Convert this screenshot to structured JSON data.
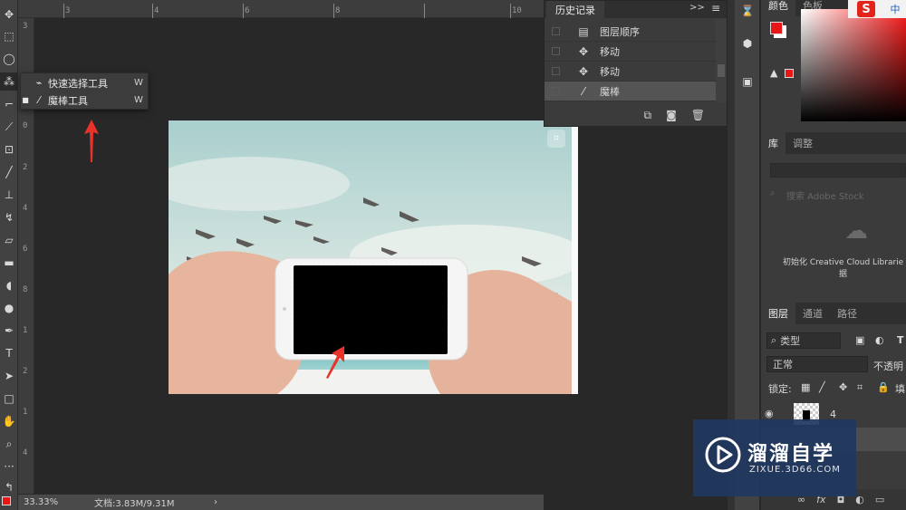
{
  "flyout": {
    "items": [
      {
        "label": "快速选择工具",
        "shortcut": "W",
        "active": false
      },
      {
        "label": "魔棒工具",
        "shortcut": "W",
        "active": true
      }
    ]
  },
  "ruler": {
    "top_ticks": [
      "3",
      "4",
      "6",
      "8",
      "10"
    ],
    "left_ticks": [
      "3",
      "0",
      "2",
      "4",
      "6",
      "8",
      "1",
      "2",
      "1",
      "4",
      "1",
      "6",
      "1",
      "8",
      "1"
    ]
  },
  "statusbar": {
    "zoom": "33.33%",
    "doc_info": "文档:3.83M/9.31M",
    "arrow": "›"
  },
  "history": {
    "tab_label": "历史记录",
    "menu_glyph": ">>",
    "rows": [
      {
        "label": "图层顺序",
        "icon": "document-icon",
        "selected": false
      },
      {
        "label": "移动",
        "icon": "move-icon",
        "selected": false
      },
      {
        "label": "移动",
        "icon": "move-icon",
        "selected": false
      },
      {
        "label": "魔棒",
        "icon": "magic-wand-icon",
        "selected": true
      }
    ]
  },
  "panels": {
    "color_tabs": [
      "颜色",
      "色板"
    ],
    "library_tabs": [
      "库",
      "调整"
    ],
    "library_search_placeholder": "搜索 Adobe Stock",
    "cloud_message": "初始化 Creative Cloud Librarie",
    "cloud_message_2": "据",
    "layer_tabs": [
      "图层",
      "通道",
      "路径"
    ],
    "layer_filter": "类型",
    "blend_mode": "正常",
    "opacity_label": "不透明",
    "lock_label": "锁定:",
    "fill_label": "填",
    "layer_number": "4"
  },
  "watermark": {
    "title": "溜溜自学",
    "subtitle": "ZIXUE.3D66.COM"
  },
  "sohu": {
    "badge": "S",
    "zh": "中"
  },
  "colors": {
    "foreground": "#e81616",
    "background": "#ffffff",
    "accent_arrow": "#e8322a"
  }
}
